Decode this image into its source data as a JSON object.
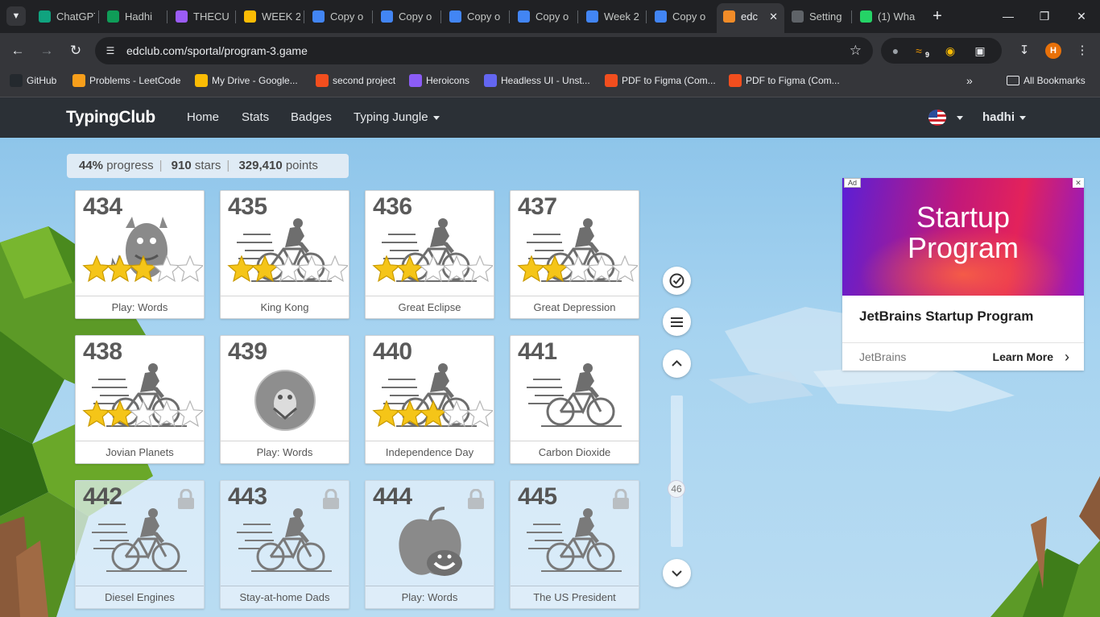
{
  "browser": {
    "tabs": [
      {
        "label": "ChatGPT",
        "icon": "chatgpt-icon",
        "color": "#10a37f"
      },
      {
        "label": "Hadhi",
        "icon": "sheets-icon",
        "color": "#0f9d58"
      },
      {
        "label": "THECU",
        "icon": "vite-icon",
        "color": "#9b5cf6"
      },
      {
        "label": "WEEK 2",
        "icon": "drive-icon",
        "color": "#fbbc04"
      },
      {
        "label": "Copy o",
        "icon": "docs-icon",
        "color": "#4285f4"
      },
      {
        "label": "Copy o",
        "icon": "docs-icon",
        "color": "#4285f4"
      },
      {
        "label": "Copy o",
        "icon": "docs-icon",
        "color": "#4285f4"
      },
      {
        "label": "Copy o",
        "icon": "docs-icon",
        "color": "#4285f4"
      },
      {
        "label": "Week 2",
        "icon": "docs-icon",
        "color": "#4285f4"
      },
      {
        "label": "Copy o",
        "icon": "docs-icon",
        "color": "#4285f4"
      },
      {
        "label": "edc",
        "icon": "edclub-icon",
        "color": "#f28c28"
      },
      {
        "label": "Setting",
        "icon": "gear-icon",
        "color": "#5f6368"
      },
      {
        "label": "(1) Wha",
        "icon": "whatsapp-icon",
        "color": "#25d366"
      }
    ],
    "url": "edclub.com/sportal/program-3.game",
    "ext_badge": "9",
    "profile_initial": "H",
    "bookmarks": [
      {
        "label": "GitHub",
        "icon": "github-icon",
        "color": "#24292e"
      },
      {
        "label": "Problems - LeetCode",
        "icon": "leetcode-icon",
        "color": "#f89f1b"
      },
      {
        "label": "My Drive - Google...",
        "icon": "drive-icon",
        "color": "#fbbc04"
      },
      {
        "label": "second project",
        "icon": "figma-icon",
        "color": "#f24e1e"
      },
      {
        "label": "Heroicons",
        "icon": "heroicons-icon",
        "color": "#8b5cf6"
      },
      {
        "label": "Headless UI - Unst...",
        "icon": "headlessui-icon",
        "color": "#6366f1"
      },
      {
        "label": "PDF to Figma (Com...",
        "icon": "figma-icon",
        "color": "#f24e1e"
      },
      {
        "label": "PDF to Figma (Com...",
        "icon": "figma-icon",
        "color": "#f24e1e"
      }
    ],
    "all_bookmarks": "All Bookmarks"
  },
  "site": {
    "logo": "TypingClub",
    "nav": [
      "Home",
      "Stats",
      "Badges",
      "Typing Jungle"
    ],
    "user": "hadhi"
  },
  "progress": {
    "percent": "44%",
    "percent_label": "progress",
    "stars": "910",
    "stars_label": "stars",
    "points": "329,410",
    "points_label": "points"
  },
  "lessons": [
    {
      "number": "434",
      "title": "Play: Words",
      "stars": 3,
      "locked": false,
      "art": "monster"
    },
    {
      "number": "435",
      "title": "King Kong",
      "stars": 2,
      "locked": false,
      "art": "bike"
    },
    {
      "number": "436",
      "title": "Great Eclipse",
      "stars": 2,
      "locked": false,
      "art": "bike"
    },
    {
      "number": "437",
      "title": "Great Depression",
      "stars": 2,
      "locked": false,
      "art": "bike"
    },
    {
      "number": "438",
      "title": "Jovian Planets",
      "stars": 2,
      "locked": false,
      "art": "bike"
    },
    {
      "number": "439",
      "title": "Play: Words",
      "stars": 0,
      "locked": false,
      "art": "ball"
    },
    {
      "number": "440",
      "title": "Independence Day",
      "stars": 3,
      "locked": false,
      "art": "bike"
    },
    {
      "number": "441",
      "title": "Carbon Dioxide",
      "stars": 0,
      "locked": false,
      "art": "bike-plain"
    },
    {
      "number": "442",
      "title": "Diesel Engines",
      "stars": 0,
      "locked": true,
      "art": "bike-plain"
    },
    {
      "number": "443",
      "title": "Stay-at-home Dads",
      "stars": 0,
      "locked": true,
      "art": "bike-plain"
    },
    {
      "number": "444",
      "title": "Play: Words",
      "stars": 0,
      "locked": true,
      "art": "apple"
    },
    {
      "number": "445",
      "title": "The US President",
      "stars": 0,
      "locked": true,
      "art": "bike-plain"
    }
  ],
  "scroll": {
    "page_indicator": "46"
  },
  "ad": {
    "tag": "Ad",
    "heading_line1": "Startup",
    "heading_line2": "Program",
    "title": "JetBrains Startup Program",
    "brand": "JetBrains",
    "cta": "Learn More"
  }
}
